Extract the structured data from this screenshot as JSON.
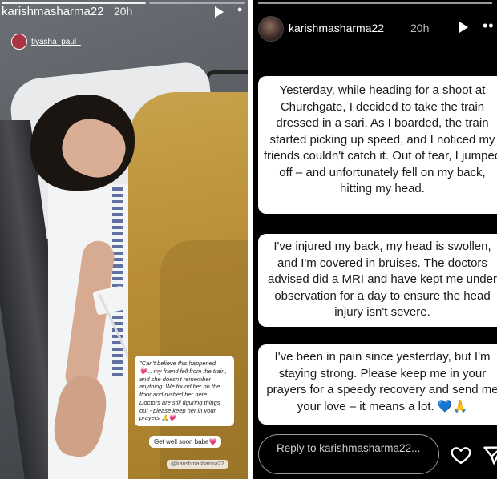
{
  "left_story": {
    "username": "karishmasharma22",
    "time": "20h",
    "tagged_user": "tiyasha_paul_",
    "caption": "\"Can't believe this happened 💗... my friend fell from the train, and she doesn't remember anything. We found her on the floor and rushed her here. Doctors are still figuring things out - please keep her in your prayers 🙏💗",
    "wish": "Get well soon babe💗",
    "mention": "@karishmasharma22"
  },
  "right_story": {
    "username": "karishmasharma22",
    "time": "20h",
    "paragraph1": "Yesterday, while heading for a shoot at Churchgate, I decided to take the train dressed in a sari. As I boarded, the train started picking up speed, and I noticed my friends couldn't catch it. Out of fear, I jumped off – and unfortunately fell on my back, hitting my head.",
    "paragraph2": "I've injured my back, my head is swollen, and I'm covered in bruises. The doctors advised did a MRI and have kept me under observation for a day to ensure the head injury isn't severe.",
    "paragraph3": "I've been in pain since yesterday, but I'm staying strong. Please keep me in your prayers for a speedy recovery and send me your love – it means a lot. 💙🙏",
    "reply_placeholder": "Reply to karishmasharma22..."
  },
  "icons": {
    "play": "play-icon",
    "more": "more-icon",
    "heart": "heart-icon",
    "send": "send-icon"
  }
}
